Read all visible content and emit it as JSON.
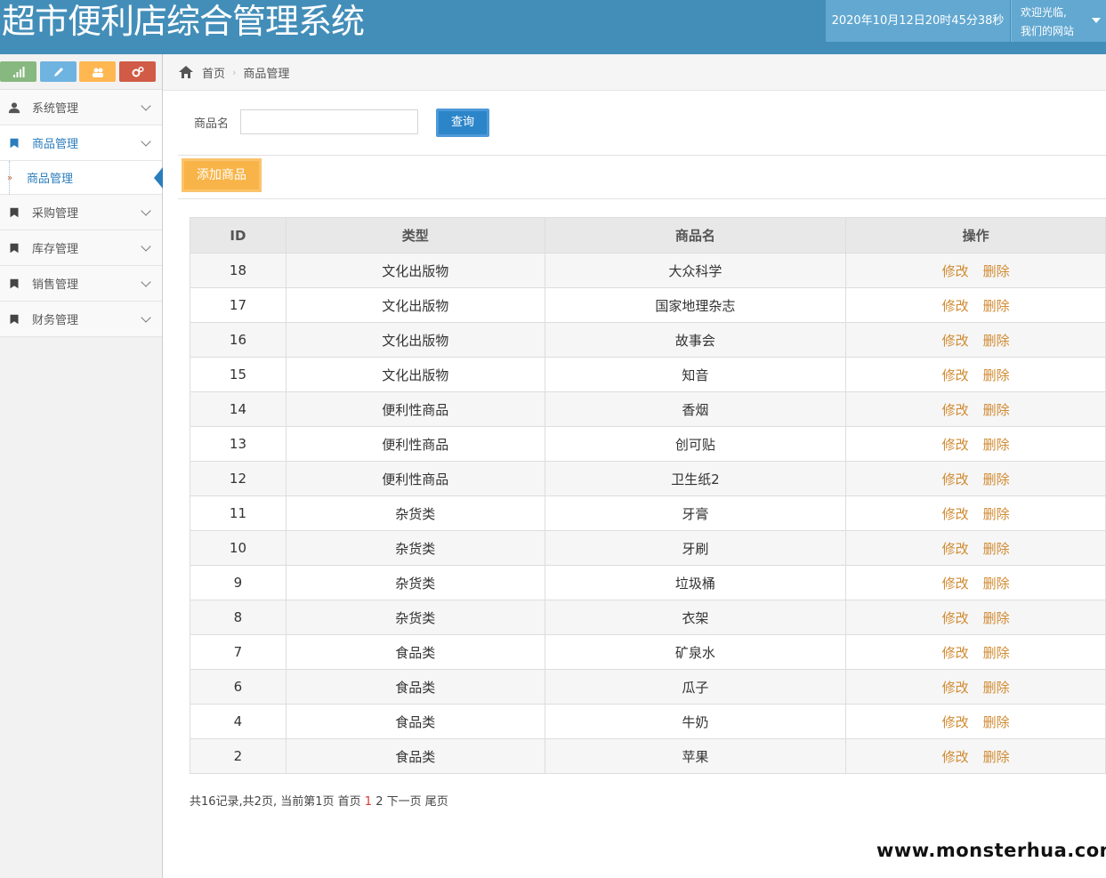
{
  "header": {
    "title": "超市便利店综合管理系统",
    "datetime": "2020年10月12日20时45分38秒",
    "welcome_line1": "欢迎光临,",
    "welcome_line2": "我们的网站"
  },
  "shortcuts": [
    {
      "icon": "signal-icon",
      "color": "#87b87f"
    },
    {
      "icon": "pencil-icon",
      "color": "#6fb3e0"
    },
    {
      "icon": "users-icon",
      "color": "#ffb752"
    },
    {
      "icon": "cogs-icon",
      "color": "#d15b47"
    }
  ],
  "sidebar": {
    "items": [
      {
        "label": "系统管理",
        "icon": "user-icon"
      },
      {
        "label": "商品管理",
        "icon": "bookmark-icon"
      },
      {
        "label": "商品管理",
        "icon": "sub-item"
      },
      {
        "label": "采购管理",
        "icon": "bookmark-icon"
      },
      {
        "label": "库存管理",
        "icon": "bookmark-icon"
      },
      {
        "label": "销售管理",
        "icon": "bookmark-icon"
      },
      {
        "label": "财务管理",
        "icon": "bookmark-icon"
      }
    ]
  },
  "breadcrumb": {
    "home": "首页",
    "current": "商品管理"
  },
  "search": {
    "label": "商品名",
    "value": "",
    "button": "查询"
  },
  "add_button": "添加商品",
  "table": {
    "headers": [
      "ID",
      "类型",
      "商品名",
      "操作"
    ],
    "edit_label": "修改",
    "delete_label": "删除",
    "rows": [
      [
        "18",
        "文化出版物",
        "大众科学"
      ],
      [
        "17",
        "文化出版物",
        "国家地理杂志"
      ],
      [
        "16",
        "文化出版物",
        "故事会"
      ],
      [
        "15",
        "文化出版物",
        "知音"
      ],
      [
        "14",
        "便利性商品",
        "香烟"
      ],
      [
        "13",
        "便利性商品",
        "创可贴"
      ],
      [
        "12",
        "便利性商品",
        "卫生纸2"
      ],
      [
        "11",
        "杂货类",
        "牙膏"
      ],
      [
        "10",
        "杂货类",
        "牙刷"
      ],
      [
        "9",
        "杂货类",
        "垃圾桶"
      ],
      [
        "8",
        "杂货类",
        "衣架"
      ],
      [
        "7",
        "食品类",
        "矿泉水"
      ],
      [
        "6",
        "食品类",
        "瓜子"
      ],
      [
        "4",
        "食品类",
        "牛奶"
      ],
      [
        "2",
        "食品类",
        "苹果"
      ]
    ]
  },
  "pager": {
    "summary": "共16记录,共2页, 当前第1页",
    "first": "首页",
    "page1": "1",
    "page2": "2",
    "next": "下一页",
    "last": "尾页"
  },
  "watermark": "www.monsterhua.com"
}
